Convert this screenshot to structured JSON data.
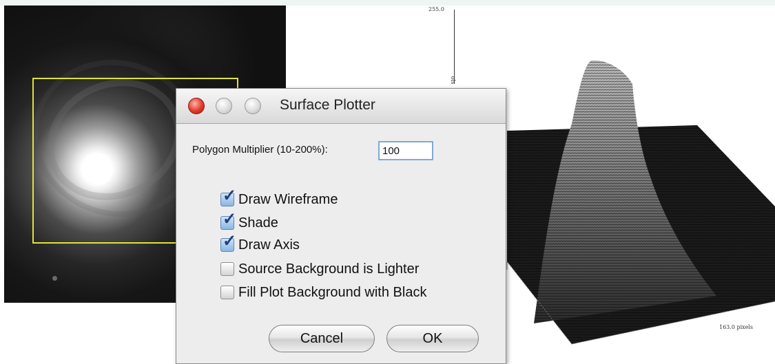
{
  "dialog": {
    "title": "Surface Plotter",
    "polygon_multiplier": {
      "label": "Polygon Multiplier (10-200%):",
      "value": "100"
    },
    "options": [
      {
        "label": "Draw Wireframe",
        "checked": true
      },
      {
        "label": "Shade",
        "checked": true
      },
      {
        "label": "Draw Axis",
        "checked": true
      },
      {
        "label": "Source Background is Lighter",
        "checked": false
      },
      {
        "label": "Fill Plot Background with Black",
        "checked": false
      }
    ],
    "buttons": {
      "cancel": "Cancel",
      "ok": "OK"
    }
  },
  "plot": {
    "z_axis_max": "255.0",
    "x_axis_label": "163.0 pixels",
    "y_axis_label_fragment": "ols"
  },
  "colors": {
    "roi_outline": "#e2e23a",
    "close_button": "#e0392b",
    "checkbox_checked": "#8bb6e2"
  }
}
